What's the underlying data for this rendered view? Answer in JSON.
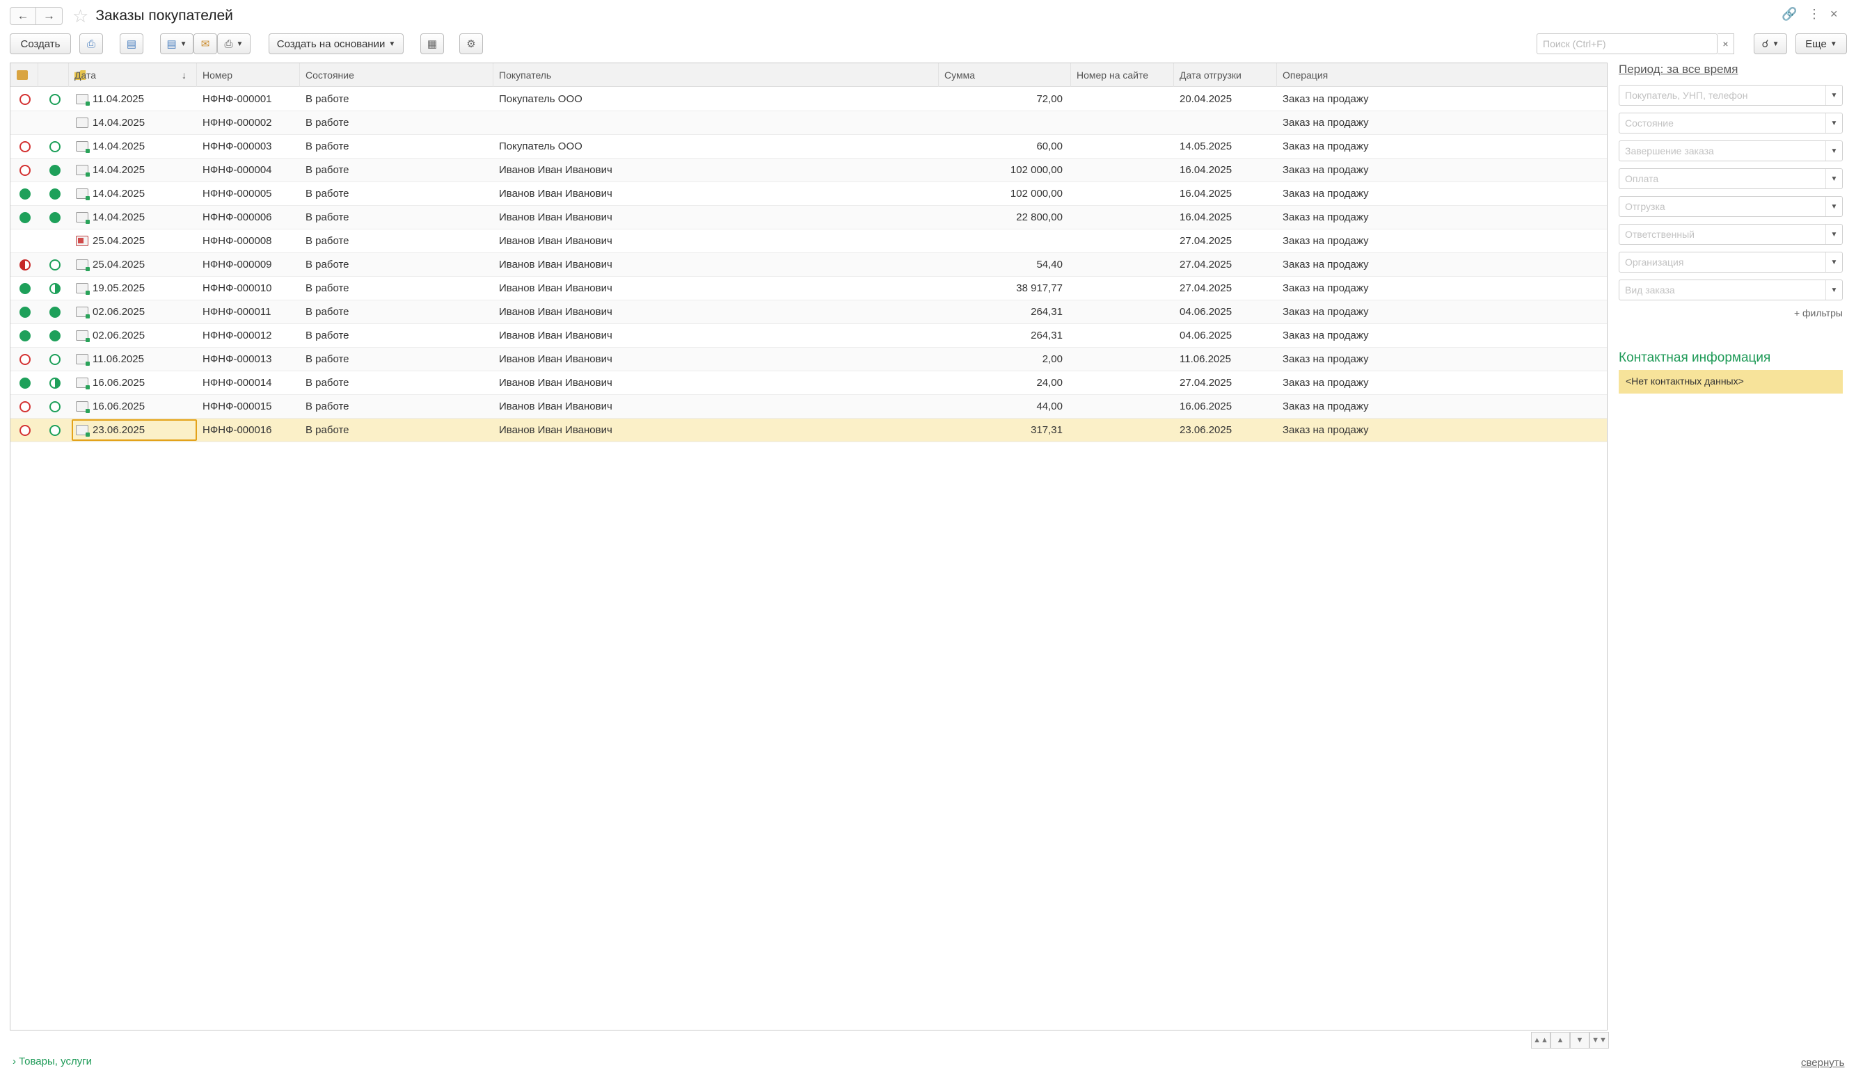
{
  "window": {
    "title": "Заказы покупателей"
  },
  "toolbar": {
    "create_label": "Создать",
    "create_based_label": "Создать на основании",
    "search_placeholder": "Поиск (Ctrl+F)",
    "more_label": "Еще"
  },
  "grid": {
    "columns": [
      "Дата",
      "Номер",
      "Состояние",
      "Покупатель",
      "Сумма",
      "Номер на сайте",
      "Дата отгрузки",
      "Операция"
    ],
    "rows": [
      {
        "s1": "red-ring",
        "s2": "green-ring",
        "icon": "ok",
        "date": "11.04.2025",
        "number": "НФНФ-000001",
        "state": "В работе",
        "buyer": "Покупатель ООО",
        "sum": "72,00",
        "site": "",
        "ship": "20.04.2025",
        "op": "Заказ на продажу"
      },
      {
        "s1": "",
        "s2": "",
        "icon": "plain",
        "date": "14.04.2025",
        "number": "НФНФ-000002",
        "state": "В работе",
        "buyer": "",
        "sum": "",
        "site": "",
        "ship": "",
        "op": "Заказ на продажу"
      },
      {
        "s1": "red-ring",
        "s2": "green-ring",
        "icon": "ok",
        "date": "14.04.2025",
        "number": "НФНФ-000003",
        "state": "В работе",
        "buyer": "Покупатель ООО",
        "sum": "60,00",
        "site": "",
        "ship": "14.05.2025",
        "op": "Заказ на продажу"
      },
      {
        "s1": "red-ring",
        "s2": "green",
        "icon": "ok",
        "date": "14.04.2025",
        "number": "НФНФ-000004",
        "state": "В работе",
        "buyer": "Иванов Иван Иванович",
        "sum": "102 000,00",
        "site": "",
        "ship": "16.04.2025",
        "op": "Заказ на продажу"
      },
      {
        "s1": "green",
        "s2": "green",
        "icon": "ok",
        "date": "14.04.2025",
        "number": "НФНФ-000005",
        "state": "В работе",
        "buyer": "Иванов Иван Иванович",
        "sum": "102 000,00",
        "site": "",
        "ship": "16.04.2025",
        "op": "Заказ на продажу"
      },
      {
        "s1": "green",
        "s2": "green",
        "icon": "ok",
        "date": "14.04.2025",
        "number": "НФНФ-000006",
        "state": "В работе",
        "buyer": "Иванов Иван Иванович",
        "sum": "22 800,00",
        "site": "",
        "ship": "16.04.2025",
        "op": "Заказ на продажу"
      },
      {
        "s1": "",
        "s2": "",
        "icon": "del",
        "date": "25.04.2025",
        "number": "НФНФ-000008",
        "state": "В работе",
        "buyer": "Иванов Иван Иванович",
        "sum": "",
        "site": "",
        "ship": "27.04.2025",
        "op": "Заказ на продажу"
      },
      {
        "s1": "red-half",
        "s2": "green-ring",
        "icon": "ok",
        "date": "25.04.2025",
        "number": "НФНФ-000009",
        "state": "В работе",
        "buyer": "Иванов Иван Иванович",
        "sum": "54,40",
        "site": "",
        "ship": "27.04.2025",
        "op": "Заказ на продажу"
      },
      {
        "s1": "green",
        "s2": "green-half",
        "icon": "ok",
        "date": "19.05.2025",
        "number": "НФНФ-000010",
        "state": "В работе",
        "buyer": "Иванов Иван Иванович",
        "sum": "38 917,77",
        "site": "",
        "ship": "27.04.2025",
        "op": "Заказ на продажу"
      },
      {
        "s1": "green",
        "s2": "green",
        "icon": "ok",
        "date": "02.06.2025",
        "number": "НФНФ-000011",
        "state": "В работе",
        "buyer": "Иванов Иван Иванович",
        "sum": "264,31",
        "site": "",
        "ship": "04.06.2025",
        "op": "Заказ на продажу"
      },
      {
        "s1": "green",
        "s2": "green",
        "icon": "ok",
        "date": "02.06.2025",
        "number": "НФНФ-000012",
        "state": "В работе",
        "buyer": "Иванов Иван Иванович",
        "sum": "264,31",
        "site": "",
        "ship": "04.06.2025",
        "op": "Заказ на продажу"
      },
      {
        "s1": "red-ring",
        "s2": "green-ring",
        "icon": "ok",
        "date": "11.06.2025",
        "number": "НФНФ-000013",
        "state": "В работе",
        "buyer": "Иванов Иван Иванович",
        "sum": "2,00",
        "site": "",
        "ship": "11.06.2025",
        "op": "Заказ на продажу"
      },
      {
        "s1": "green",
        "s2": "green-half",
        "icon": "ok",
        "date": "16.06.2025",
        "number": "НФНФ-000014",
        "state": "В работе",
        "buyer": "Иванов Иван Иванович",
        "sum": "24,00",
        "site": "",
        "ship": "27.04.2025",
        "op": "Заказ на продажу"
      },
      {
        "s1": "red-ring",
        "s2": "green-ring",
        "icon": "ok",
        "date": "16.06.2025",
        "number": "НФНФ-000015",
        "state": "В работе",
        "buyer": "Иванов Иван Иванович",
        "sum": "44,00",
        "site": "",
        "ship": "16.06.2025",
        "op": "Заказ на продажу"
      },
      {
        "s1": "red-ring",
        "s2": "green-ring",
        "icon": "ok",
        "date": "23.06.2025",
        "number": "НФНФ-000016",
        "state": "В работе",
        "buyer": "Иванов Иван Иванович",
        "sum": "317,31",
        "site": "",
        "ship": "23.06.2025",
        "op": "Заказ на продажу",
        "selected": true
      }
    ]
  },
  "right_panel": {
    "period_label": "Период: за все время",
    "filters": [
      "Покупатель, УНП, телефон",
      "Состояние",
      "Завершение заказа",
      "Оплата",
      "Отгрузка",
      "Ответственный",
      "Организация",
      "Вид заказа"
    ],
    "more_filters_label": "+ фильтры",
    "contact_title": "Контактная информация",
    "contact_empty": "<Нет контактных данных>"
  },
  "footer": {
    "goods_label": "Товары, услуги",
    "collapse_label": "свернуть"
  },
  "icons": [
    "back-arrow-icon",
    "forward-arrow-icon",
    "star-icon",
    "link-icon",
    "more-vertical-icon",
    "close-icon",
    "search-icon"
  ],
  "colors": {
    "accent_green": "#1ea05a",
    "status_red": "#d43333",
    "selected_row": "#fbf0c8",
    "focus_frame": "#e3a21a",
    "contact_box": "#f7e39a"
  }
}
